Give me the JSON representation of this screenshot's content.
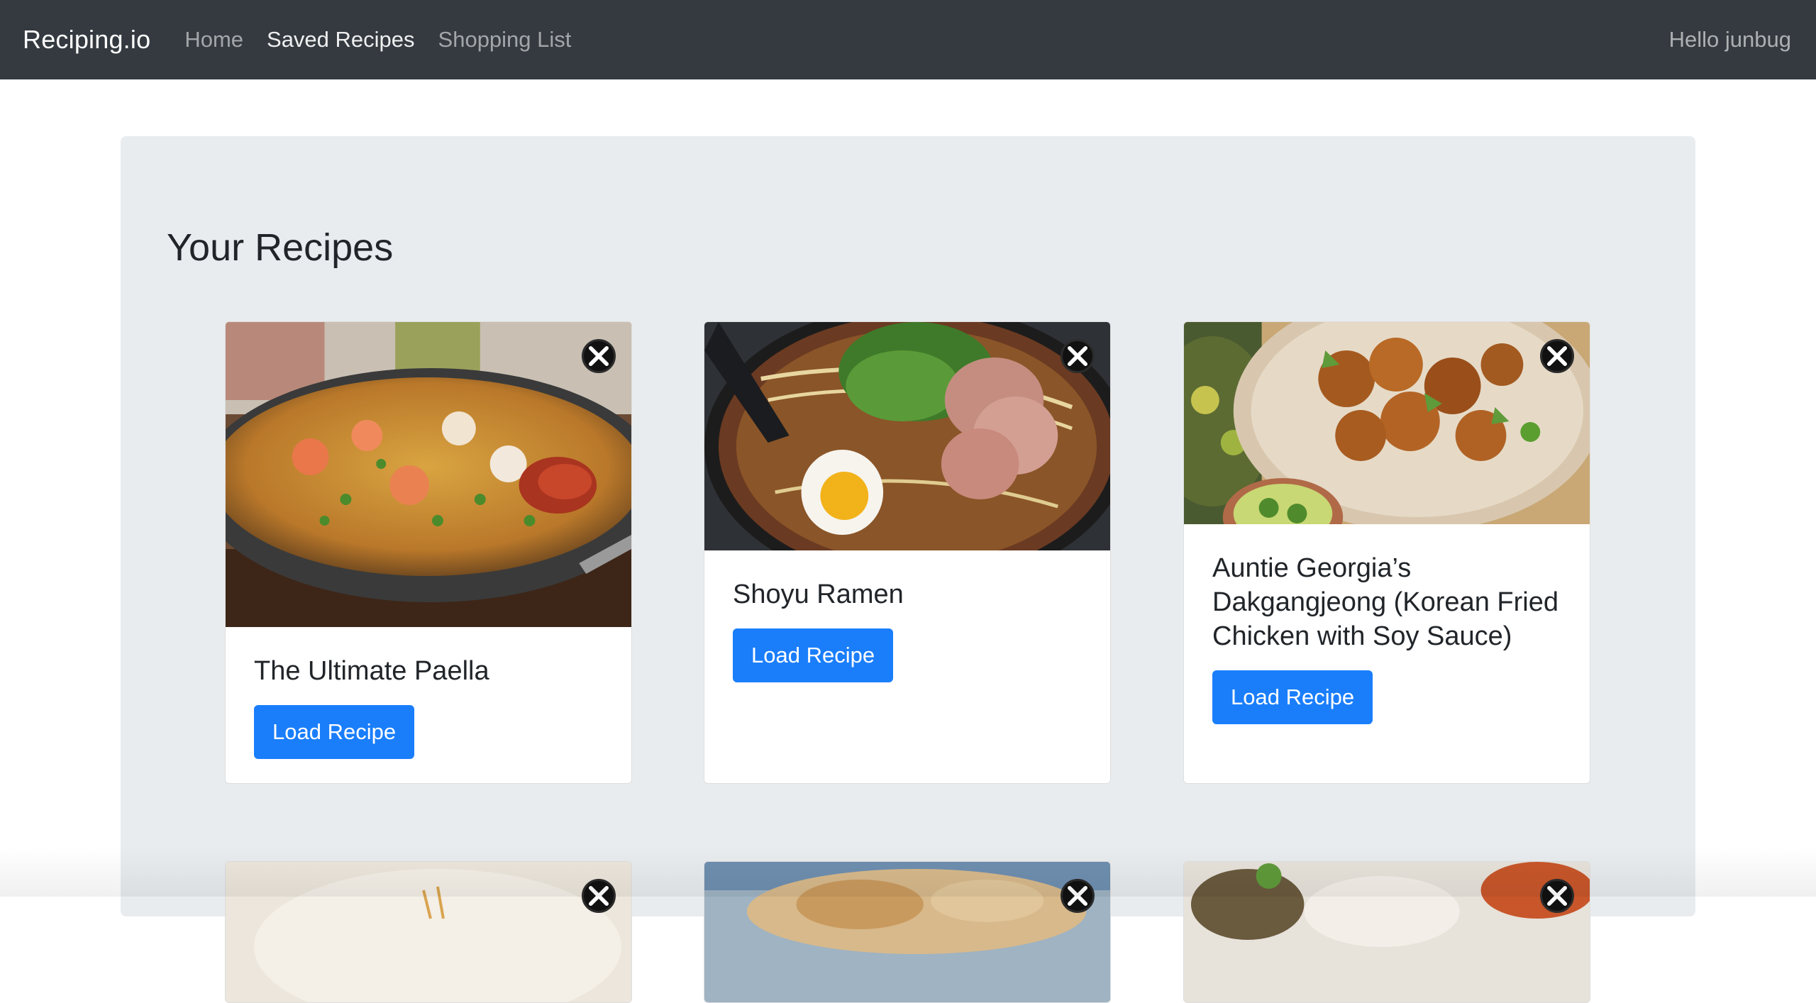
{
  "navbar": {
    "brand": "Reciping.io",
    "links": [
      {
        "label": "Home"
      },
      {
        "label": "Saved Recipes"
      },
      {
        "label": "Shopping List"
      }
    ],
    "greeting": "Hello junbug"
  },
  "main": {
    "title": "Your Recipes",
    "cards": [
      {
        "title": "The Ultimate Paella",
        "button": "Load Recipe"
      },
      {
        "title": "Shoyu Ramen",
        "button": "Load Recipe"
      },
      {
        "title": "Auntie Georgia’s Dakgangjeong (Korean Fried Chicken with Soy Sauce)",
        "button": "Load Recipe"
      }
    ]
  },
  "icons": {
    "remove": "close-icon"
  },
  "colors": {
    "navbar": "#343a40",
    "jumbotron": "#e9ecef",
    "primary": "#1a7efb"
  }
}
